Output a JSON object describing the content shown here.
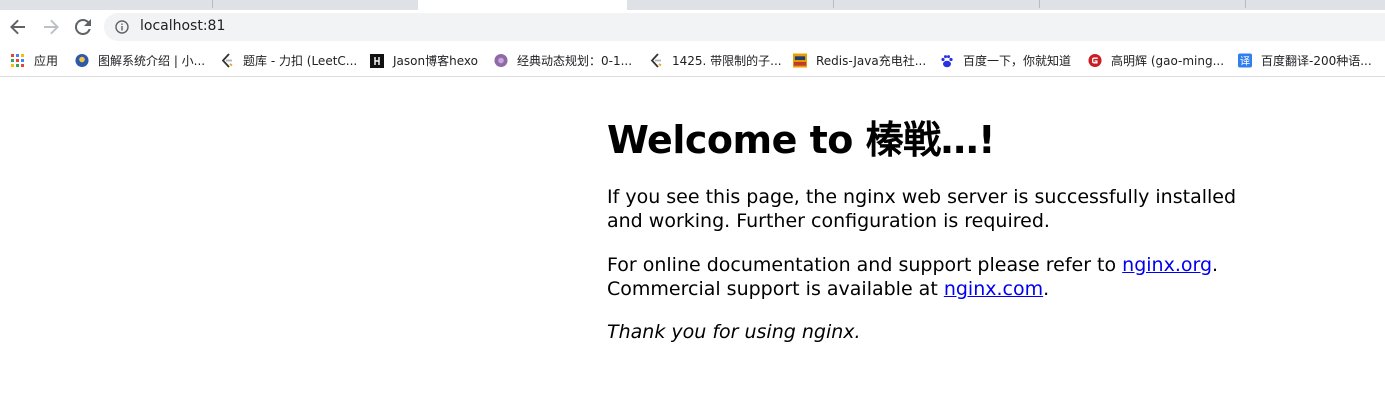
{
  "browser": {
    "url": "localhost:81",
    "bookmarks": [
      {
        "label": "应用",
        "icon": "apps-grid-icon"
      },
      {
        "label": "图解系统介绍 | 小...",
        "icon": "site-avatar-icon"
      },
      {
        "label": "题库 - 力扣 (LeetC...",
        "icon": "leetcode-icon"
      },
      {
        "label": "Jason博客hexo",
        "icon": "hexo-icon"
      },
      {
        "label": "经典动态规划：0-1...",
        "icon": "purple-circle-icon"
      },
      {
        "label": "1425. 带限制的子...",
        "icon": "leetcode-icon"
      },
      {
        "label": "Redis-Java充电社...",
        "icon": "java-icon"
      },
      {
        "label": "百度一下，你就知道",
        "icon": "baidu-paw-icon"
      },
      {
        "label": "高明辉 (gao-ming...",
        "icon": "gitee-icon"
      },
      {
        "label": "百度翻译-200种语...",
        "icon": "translate-icon"
      }
    ]
  },
  "page": {
    "heading": "Welcome to 榛戦…!",
    "p1": "If you see this page, the nginx web server is successfully installed and working. Further configuration is required.",
    "p2_prefix": "For online documentation and support please refer to ",
    "p2_link1": "nginx.org",
    "p2_mid": ".",
    "p2_line2_prefix": "Commercial support is available at ",
    "p2_link2": "nginx.com",
    "p2_suffix": ".",
    "p3": "Thank you for using nginx."
  }
}
